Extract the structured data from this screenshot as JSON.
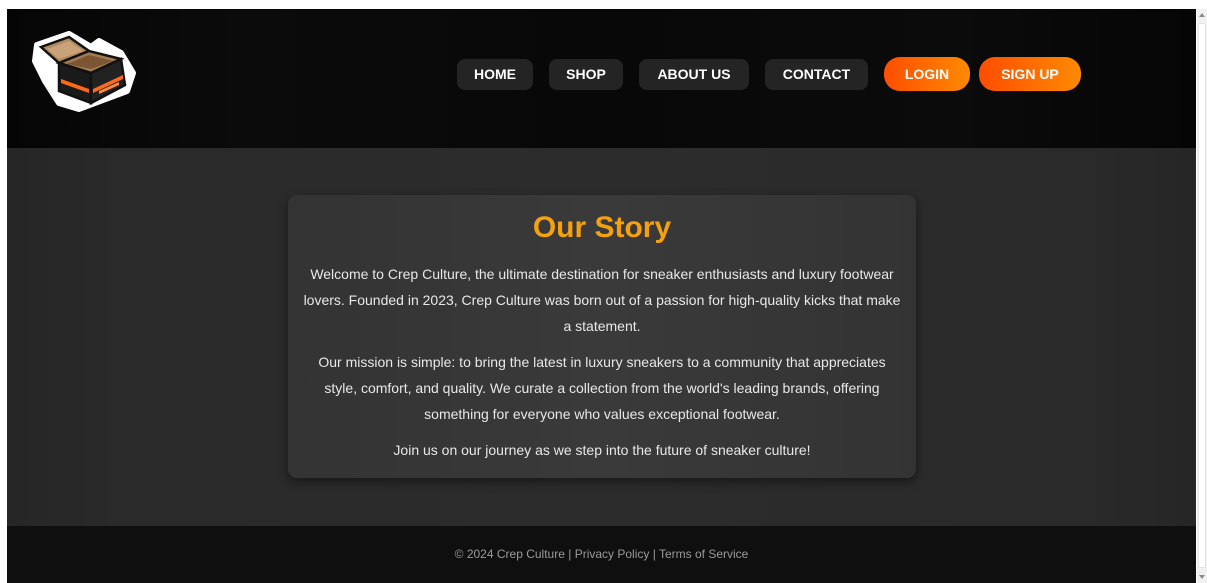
{
  "header": {
    "logo_icon": "open-sneaker-box-icon",
    "nav": [
      {
        "label": "HOME",
        "style": "dark"
      },
      {
        "label": "SHOP",
        "style": "dark"
      },
      {
        "label": "ABOUT US",
        "style": "dark"
      },
      {
        "label": "CONTACT",
        "style": "dark"
      },
      {
        "label": "LOGIN",
        "style": "orange"
      },
      {
        "label": "SIGN UP",
        "style": "orange"
      }
    ]
  },
  "story": {
    "title": "Our Story",
    "paragraphs": [
      "Welcome to Crep Culture, the ultimate destination for sneaker enthusiasts and luxury footwear lovers. Founded in 2023, Crep Culture was born out of a passion for high-quality kicks that make a statement.",
      "Our mission is simple: to bring the latest in luxury sneakers to a community that appreciates style, comfort, and quality. We curate a collection from the world's leading brands, offering something for everyone who values exceptional footwear.",
      "Join us on our journey as we step into the future of sneaker culture!"
    ]
  },
  "footer": {
    "copyright": "© 2024 Crep Culture",
    "separator": "|",
    "privacy": "Privacy Policy",
    "terms": "Terms of Service"
  },
  "colors": {
    "accent_orange": "#ff5a00",
    "title_gold": "#f5a00f",
    "header_bg": "#080808",
    "page_bg": "#2b2b2b"
  }
}
